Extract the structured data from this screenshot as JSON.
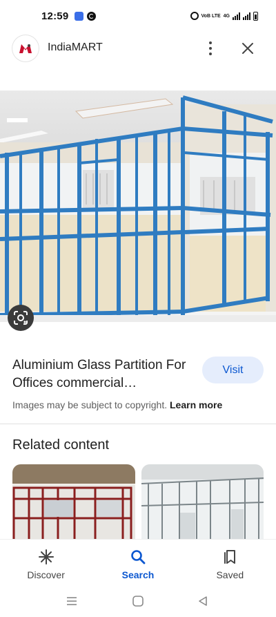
{
  "status_bar": {
    "time": "12:59",
    "network_text": "VoB LTE",
    "network_type": "4G",
    "icons": [
      "meet-icon",
      "g-app-icon",
      "alarm-icon",
      "signal-icon",
      "battery-icon"
    ]
  },
  "header": {
    "site_name": "IndiaMART",
    "brand_color": "#c8102e"
  },
  "result": {
    "title": "Aluminium Glass Partition For Offices commercial…",
    "visit_label": "Visit",
    "copyright_text": "Images may be subject to copyright.",
    "learn_more": "Learn more"
  },
  "related": {
    "title": "Related content"
  },
  "bottom_nav": {
    "items": [
      {
        "label": "Discover",
        "icon": "asterisk-icon"
      },
      {
        "label": "Search",
        "icon": "search-icon"
      },
      {
        "label": "Saved",
        "icon": "bookmarks-icon"
      }
    ],
    "active_color": "#0b57d0"
  }
}
